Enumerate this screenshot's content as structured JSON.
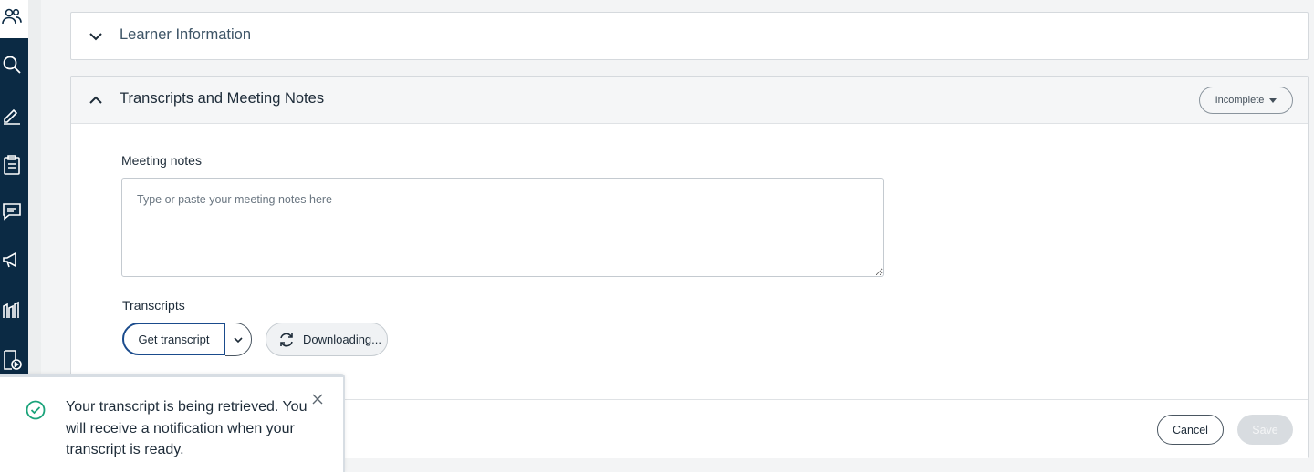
{
  "sidebar": {
    "items": [
      {
        "icon": "users-icon"
      },
      {
        "icon": "search-icon"
      },
      {
        "icon": "pen-icon"
      },
      {
        "icon": "clipboard-icon"
      },
      {
        "icon": "chat-icon"
      },
      {
        "icon": "megaphone-icon"
      },
      {
        "icon": "chart-icon"
      },
      {
        "icon": "document-play-icon"
      }
    ]
  },
  "learner_panel": {
    "title": "Learner Information",
    "expanded": false
  },
  "transcripts_panel": {
    "title": "Transcripts and Meeting Notes",
    "expanded": true,
    "status": "Incomplete",
    "meeting_notes_label": "Meeting notes",
    "meeting_notes_placeholder": "Type or paste your meeting notes here",
    "meeting_notes_value": "",
    "transcripts_label": "Transcripts",
    "get_transcript_label": "Get transcript",
    "downloading_label": "Downloading...",
    "cancel_label": "Cancel",
    "save_label": "Save"
  },
  "toast": {
    "message": "Your transcript is being retrieved. You will receive a notification when your transcript is ready."
  },
  "colors": {
    "sidebar_bg": "#0b2a44",
    "accent": "#1a4b8c",
    "success": "#1aa37a"
  }
}
